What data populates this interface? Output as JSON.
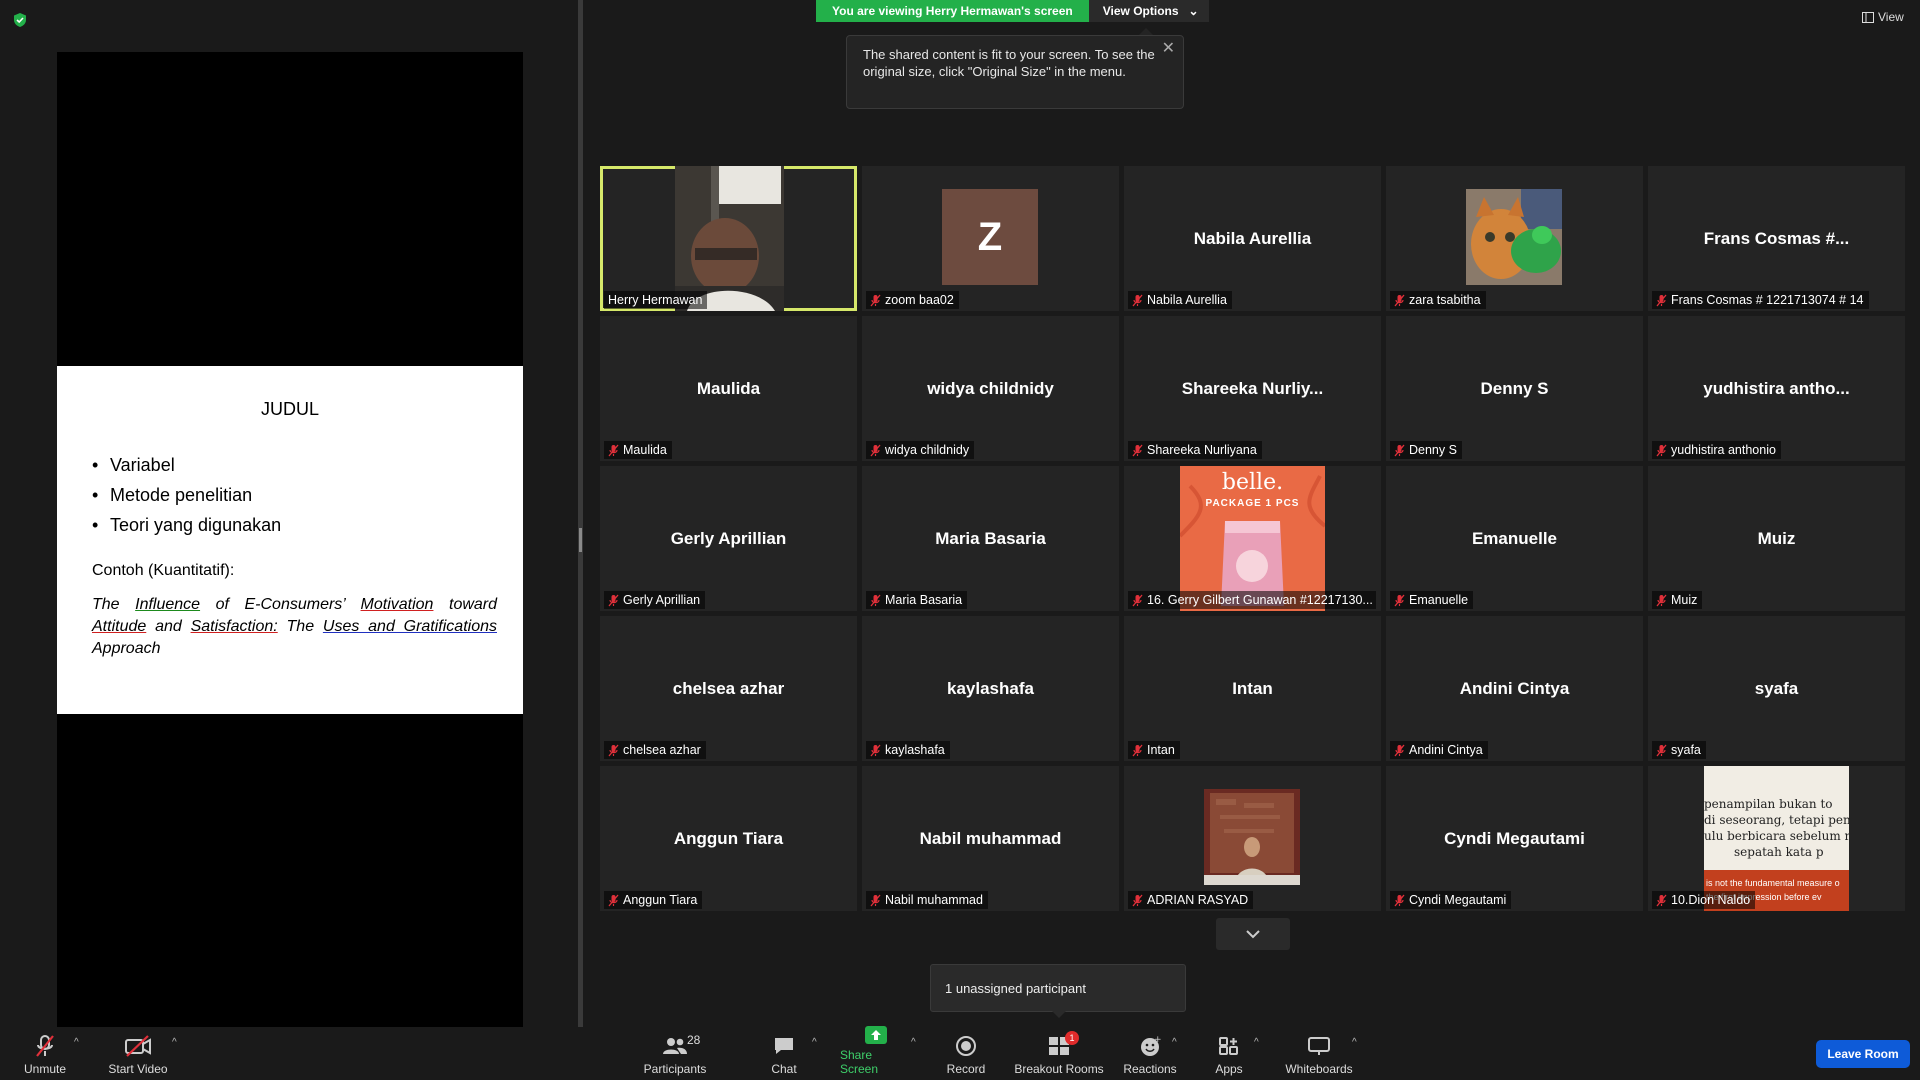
{
  "banner": {
    "viewing": "You are viewing Herry Hermawan's screen",
    "view_options": "View Options"
  },
  "tooltip": {
    "text": "The shared content is fit to your screen. To see the original size, click \"Original Size\" in the menu."
  },
  "view_label": "View",
  "slide": {
    "title": "JUDUL",
    "bullets": [
      "Variabel",
      "Metode penelitian",
      "Teori yang digunakan"
    ],
    "example_label": "Contoh (Kuantitatif):",
    "quote_parts": {
      "p1": "The ",
      "w1": "Influence",
      "p2": " of E-Consumers’ ",
      "w2": "Motivation",
      "p3": " toward ",
      "w3": "Attitude",
      "p4": " and ",
      "w4": "Satisfaction:",
      "p5": " The ",
      "w5": "Uses and Gratifications",
      "p6": " Approach"
    }
  },
  "participants": [
    {
      "center": "",
      "label": "Herry Hermawan",
      "muted": false,
      "kind": "video"
    },
    {
      "center": "",
      "label": "zoom baa02",
      "muted": true,
      "kind": "avatar",
      "avatar_letter": "Z"
    },
    {
      "center": "Nabila Aurellia",
      "label": "Nabila Aurellia",
      "muted": true,
      "kind": "name"
    },
    {
      "center": "",
      "label": "zara tsabitha",
      "muted": true,
      "kind": "cat"
    },
    {
      "center": "Frans Cosmas #...",
      "label": "Frans Cosmas # 1221713074 # 14",
      "muted": true,
      "kind": "name"
    },
    {
      "center": "Maulida",
      "label": "Maulida",
      "muted": true,
      "kind": "name"
    },
    {
      "center": "widya childnidy",
      "label": "widya childnidy",
      "muted": true,
      "kind": "name"
    },
    {
      "center": "Shareeka  Nurliy...",
      "label": "Shareeka Nurliyana",
      "muted": true,
      "kind": "name"
    },
    {
      "center": "Denny S",
      "label": "Denny S",
      "muted": true,
      "kind": "name"
    },
    {
      "center": "yudhistira  antho...",
      "label": "yudhistira anthonio",
      "muted": true,
      "kind": "name"
    },
    {
      "center": "Gerly Aprillian",
      "label": "Gerly Aprillian",
      "muted": true,
      "kind": "name"
    },
    {
      "center": "Maria Basaria",
      "label": "Maria Basaria",
      "muted": true,
      "kind": "name"
    },
    {
      "center": "",
      "label": "16. Gerry Gilbert Gunawan #12217130...",
      "muted": true,
      "kind": "belle",
      "belle_title": "belle.",
      "belle_sub": "PACKAGE 1 PCS"
    },
    {
      "center": "Emanuelle",
      "label": "Emanuelle",
      "muted": true,
      "kind": "name"
    },
    {
      "center": "Muiz",
      "label": "Muiz",
      "muted": true,
      "kind": "name"
    },
    {
      "center": "chelsea azhar",
      "label": "chelsea azhar",
      "muted": true,
      "kind": "name"
    },
    {
      "center": "kaylashafa",
      "label": "kaylashafa",
      "muted": true,
      "kind": "name"
    },
    {
      "center": "Intan",
      "label": "Intan",
      "muted": true,
      "kind": "name"
    },
    {
      "center": "Andini Cintya",
      "label": "Andini Cintya",
      "muted": true,
      "kind": "name"
    },
    {
      "center": "syafa",
      "label": "syafa",
      "muted": true,
      "kind": "name"
    },
    {
      "center": "Anggun Tiara",
      "label": "Anggun Tiara",
      "muted": true,
      "kind": "name"
    },
    {
      "center": "Nabil muhammad",
      "label": "Nabil muhammad",
      "muted": true,
      "kind": "name"
    },
    {
      "center": "",
      "label": "ADRIAN RASYAD",
      "muted": true,
      "kind": "portrait"
    },
    {
      "center": "Cyndi Megautami",
      "label": "Cyndi Megautami",
      "muted": true,
      "kind": "name"
    },
    {
      "center": "",
      "label": "10.Dion Naldo",
      "muted": true,
      "kind": "quote",
      "quote_lines": [
        "penampilan bukan to",
        "di seseorang, tetapi penan",
        "ulu berbicara sebelum m",
        "sepatah kata p"
      ],
      "quote_bottom": "is not the fundamental measure o",
      "quote_bottom2": "the first impression before ev"
    }
  ],
  "unassigned": "1 unassigned participant",
  "toolbar": {
    "unmute": "Unmute",
    "start_video": "Start Video",
    "participants": "Participants",
    "participants_count": "28",
    "chat": "Chat",
    "share_screen": "Share Screen",
    "record": "Record",
    "breakout_rooms": "Breakout Rooms",
    "breakout_badge": "1",
    "reactions": "Reactions",
    "apps": "Apps",
    "whiteboards": "Whiteboards",
    "leave_room": "Leave Room"
  },
  "colors": {
    "banner_green": "#23b04a",
    "active_speaker": "#d6e86a",
    "leave_blue": "#0e5bd8",
    "muted_red": "#e0303a"
  }
}
